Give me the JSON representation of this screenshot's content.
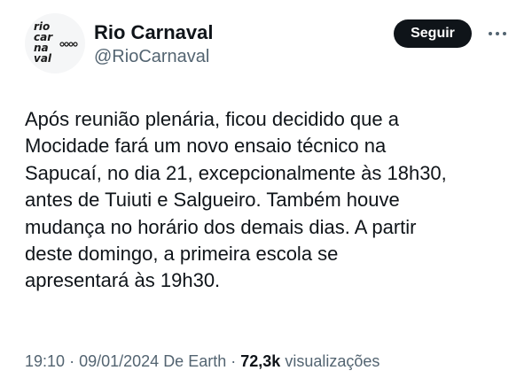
{
  "author": {
    "name": "Rio Carnaval",
    "handle": "@RioCarnaval",
    "logo_text": [
      "rio",
      "car",
      "na",
      "val"
    ]
  },
  "actions": {
    "follow_label": "Seguir",
    "more_icon": "more-dots-icon"
  },
  "tweet": {
    "lines": [
      "Após reunião plenária, ficou decidido que a",
      "Mocidade fará um novo ensaio técnico na",
      "Sapucaí, no dia 21, excepcionalmente às 18h30,",
      "antes de Tuiuti e Salgueiro. Também houve",
      "mudança no horário dos demais dias. A partir",
      "deste domingo, a primeira escola se",
      "apresentará às 19h30."
    ]
  },
  "meta": {
    "time": "19:10",
    "separator": "·",
    "date": "09/01/2024",
    "source": "De Earth",
    "views_count": "72,3k",
    "views_label": "visualizações"
  }
}
